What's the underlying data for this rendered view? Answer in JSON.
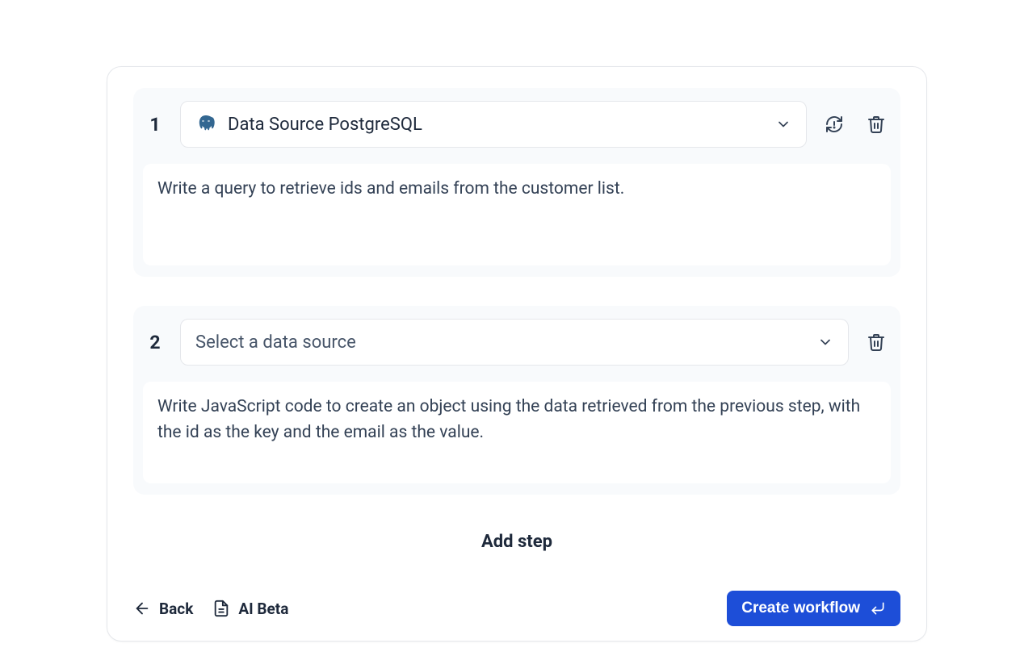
{
  "steps": [
    {
      "number": "1",
      "datasource_label": "Data Source PostgreSQL",
      "datasource_placeholder": false,
      "show_refresh": true,
      "body": "Write a query to retrieve ids and emails from the customer list."
    },
    {
      "number": "2",
      "datasource_label": "Select a data source",
      "datasource_placeholder": true,
      "show_refresh": false,
      "body": "Write JavaScript code to create an object using the data retrieved from the previous step, with the id as the key and the email as the value."
    }
  ],
  "add_step_label": "Add step",
  "footer": {
    "back_label": "Back",
    "ai_beta_label": "AI Beta",
    "create_label": "Create workflow"
  }
}
